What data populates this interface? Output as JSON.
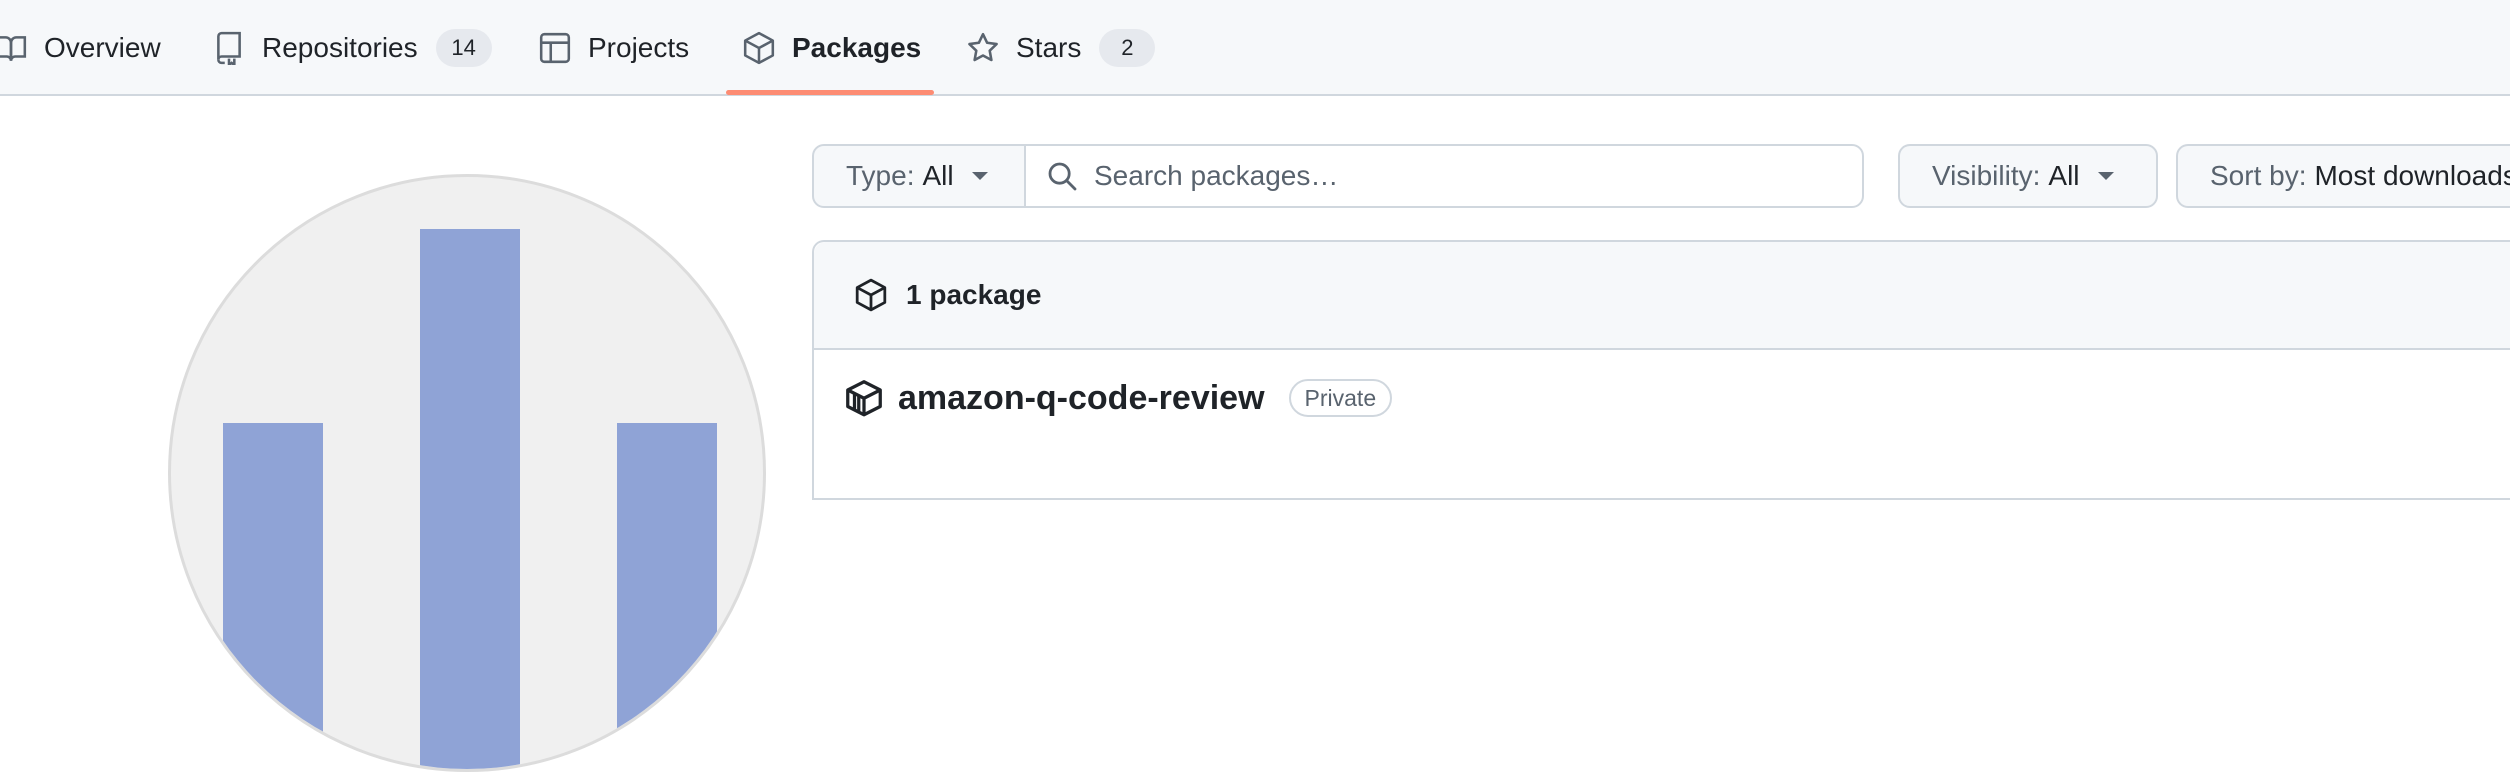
{
  "nav": {
    "tabs": [
      {
        "label": "Overview",
        "icon": "book-icon"
      },
      {
        "label": "Repositories",
        "icon": "repo-icon",
        "count": "14"
      },
      {
        "label": "Projects",
        "icon": "table-icon"
      },
      {
        "label": "Packages",
        "icon": "package-icon",
        "active": true
      },
      {
        "label": "Stars",
        "icon": "star-icon",
        "count": "2"
      }
    ],
    "active_underline_color": "#fd8c73"
  },
  "filters": {
    "type": {
      "key": "Type:",
      "value": "All"
    },
    "search": {
      "placeholder": "Search packages…"
    },
    "visibility": {
      "key": "Visibility:",
      "value": "All"
    },
    "sort": {
      "key": "Sort by:",
      "value": "Most downloads"
    }
  },
  "packages": {
    "header_count": "1 package",
    "items": [
      {
        "name": "amazon-q-code-review",
        "badge": "Private",
        "icon": "container-icon"
      }
    ]
  },
  "avatar": {
    "background_color": "#f0f0f0",
    "bar_color": "#8fa3d6"
  }
}
